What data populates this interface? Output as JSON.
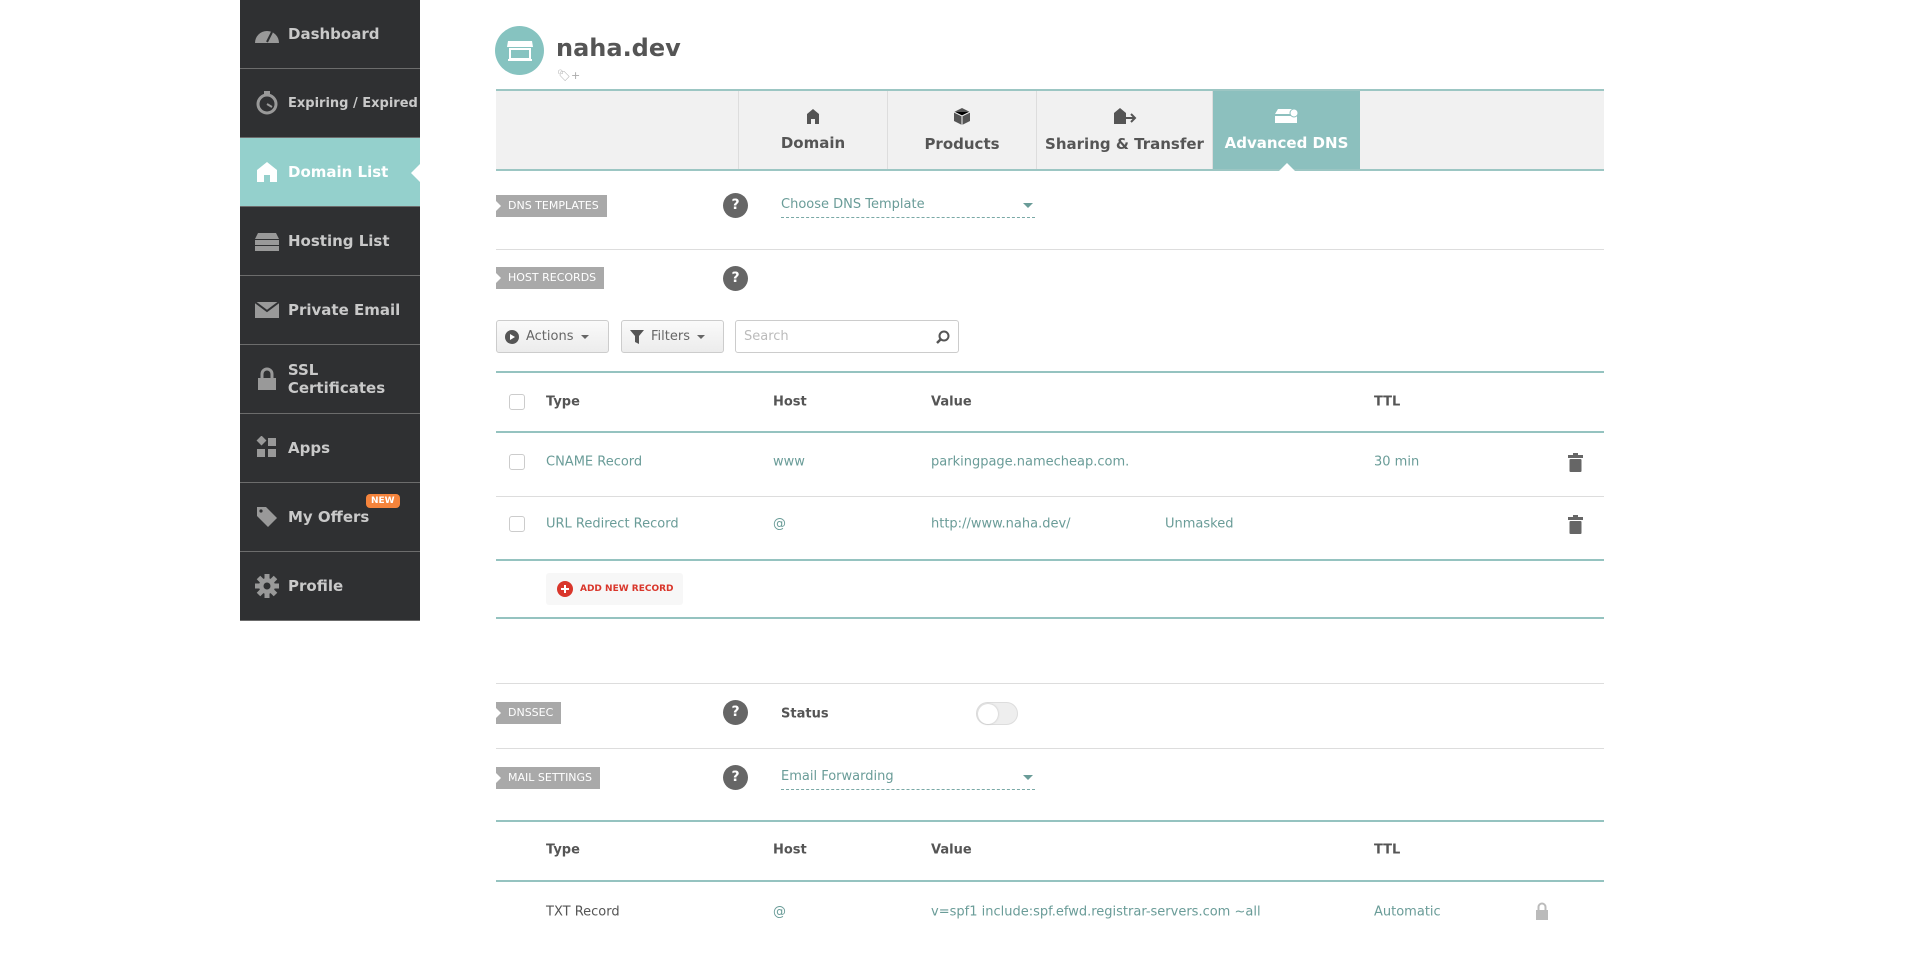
{
  "sidebar": {
    "items": [
      {
        "label": "Dashboard",
        "icon": "gauge-icon"
      },
      {
        "label": "Expiring / Expired",
        "icon": "stopwatch-icon"
      },
      {
        "label": "Domain List",
        "icon": "home-icon",
        "active": true
      },
      {
        "label": "Hosting List",
        "icon": "server-icon"
      },
      {
        "label": "Private Email",
        "icon": "envelope-icon"
      },
      {
        "label": "SSL Certificates",
        "icon": "lock-icon"
      },
      {
        "label": "Apps",
        "icon": "apps-icon"
      },
      {
        "label": "My Offers",
        "icon": "tag-icon",
        "badge": "NEW"
      },
      {
        "label": "Profile",
        "icon": "gear-icon"
      }
    ]
  },
  "header": {
    "domain": "naha.dev"
  },
  "tabs": [
    {
      "label": "Domain"
    },
    {
      "label": "Products"
    },
    {
      "label": "Sharing & Transfer"
    },
    {
      "label": "Advanced DNS",
      "active": true
    }
  ],
  "dns_templates": {
    "label": "DNS TEMPLATES",
    "help": "?",
    "dropdown": "Choose DNS Template"
  },
  "host_records": {
    "label": "HOST RECORDS",
    "help": "?",
    "actions": "Actions",
    "filters": "Filters",
    "search_placeholder": "Search",
    "columns": {
      "type": "Type",
      "host": "Host",
      "value": "Value",
      "ttl": "TTL"
    },
    "rows": [
      {
        "type": "CNAME Record",
        "host": "www",
        "value": "parkingpage.namecheap.com.",
        "extra": "",
        "ttl": "30 min"
      },
      {
        "type": "URL Redirect Record",
        "host": "@",
        "value": "http://www.naha.dev/",
        "extra": "Unmasked",
        "ttl": ""
      }
    ],
    "add_button": "ADD NEW RECORD"
  },
  "dnssec": {
    "label": "DNSSEC",
    "help": "?",
    "status_label": "Status",
    "enabled": false
  },
  "mail": {
    "label": "MAIL SETTINGS",
    "help": "?",
    "dropdown": "Email Forwarding",
    "columns": {
      "type": "Type",
      "host": "Host",
      "value": "Value",
      "ttl": "TTL"
    },
    "rows": [
      {
        "type": "TXT Record",
        "host": "@",
        "value": "v=spf1 include:spf.efwd.registrar-servers.com ~all",
        "ttl": "Automatic"
      }
    ]
  },
  "colors": {
    "accent": "#94d0cc",
    "sidebar": "#2f3032",
    "badge": "#f5843c",
    "add": "#d9362b"
  }
}
